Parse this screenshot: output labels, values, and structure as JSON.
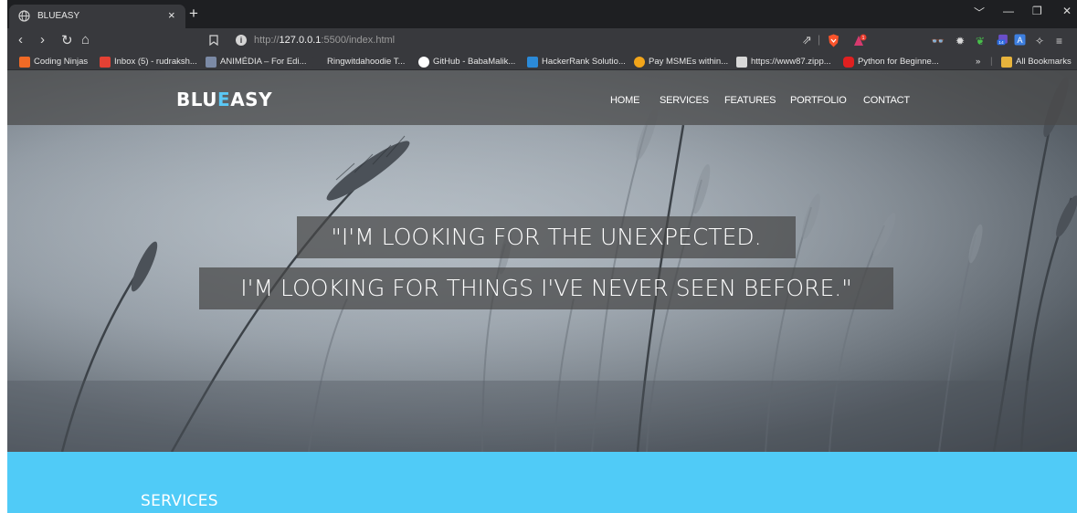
{
  "browser": {
    "tab_title": "BLUEASY",
    "tab_close": "×",
    "new_tab": "+",
    "window_controls": [
      "﹀",
      "—",
      "❐",
      "✕"
    ],
    "url_scheme": "http://",
    "url_host": "127.0.0.1",
    "url_rest": ":5500/index.html",
    "share_glyph": "⇗",
    "notification_count": "1",
    "ext_badge": "14",
    "nav": {
      "back": "‹",
      "forward": "›",
      "reload": "↻",
      "home": "⌂"
    },
    "bookmarks_more": "»",
    "bookmarks": [
      {
        "label": "Coding Ninjas",
        "color": "#f06a26"
      },
      {
        "label": "Inbox (5) - rudraksh...",
        "color": "#e44134"
      },
      {
        "label": "ANIMÉDIA – For Edi...",
        "color": "#7b8aa6"
      },
      {
        "label": "Ringwitdahoodie T...",
        "color": "#38393d"
      },
      {
        "label": "GitHub - BabaMalik...",
        "color": "#ffffff"
      },
      {
        "label": "HackerRank Solutio...",
        "color": "#2b8ad8"
      },
      {
        "label": "Pay MSMEs within...",
        "color": "#f2a51a"
      },
      {
        "label": "https://www87.zipp...",
        "color": "#d8d8d8"
      },
      {
        "label": "Python for Beginne...",
        "color": "#e02020"
      },
      {
        "label": "All Bookmarks",
        "color": "#e8b43c"
      }
    ]
  },
  "site": {
    "logo_part1": "BLU",
    "logo_accent": "E",
    "logo_part2": "ASY",
    "accent_color": "#5bc8f5",
    "nav": [
      "HOME",
      "SERVICES",
      "FEATURES",
      "PORTFOLIO",
      "CONTACT"
    ],
    "quote_line1": "\"I'M LOOKING FOR THE UNEXPECTED.",
    "quote_line2": "I'M LOOKING FOR THINGS I'VE NEVER SEEN BEFORE.\"",
    "services_heading": "SERVICES",
    "services_bg": "#50cbf7"
  }
}
